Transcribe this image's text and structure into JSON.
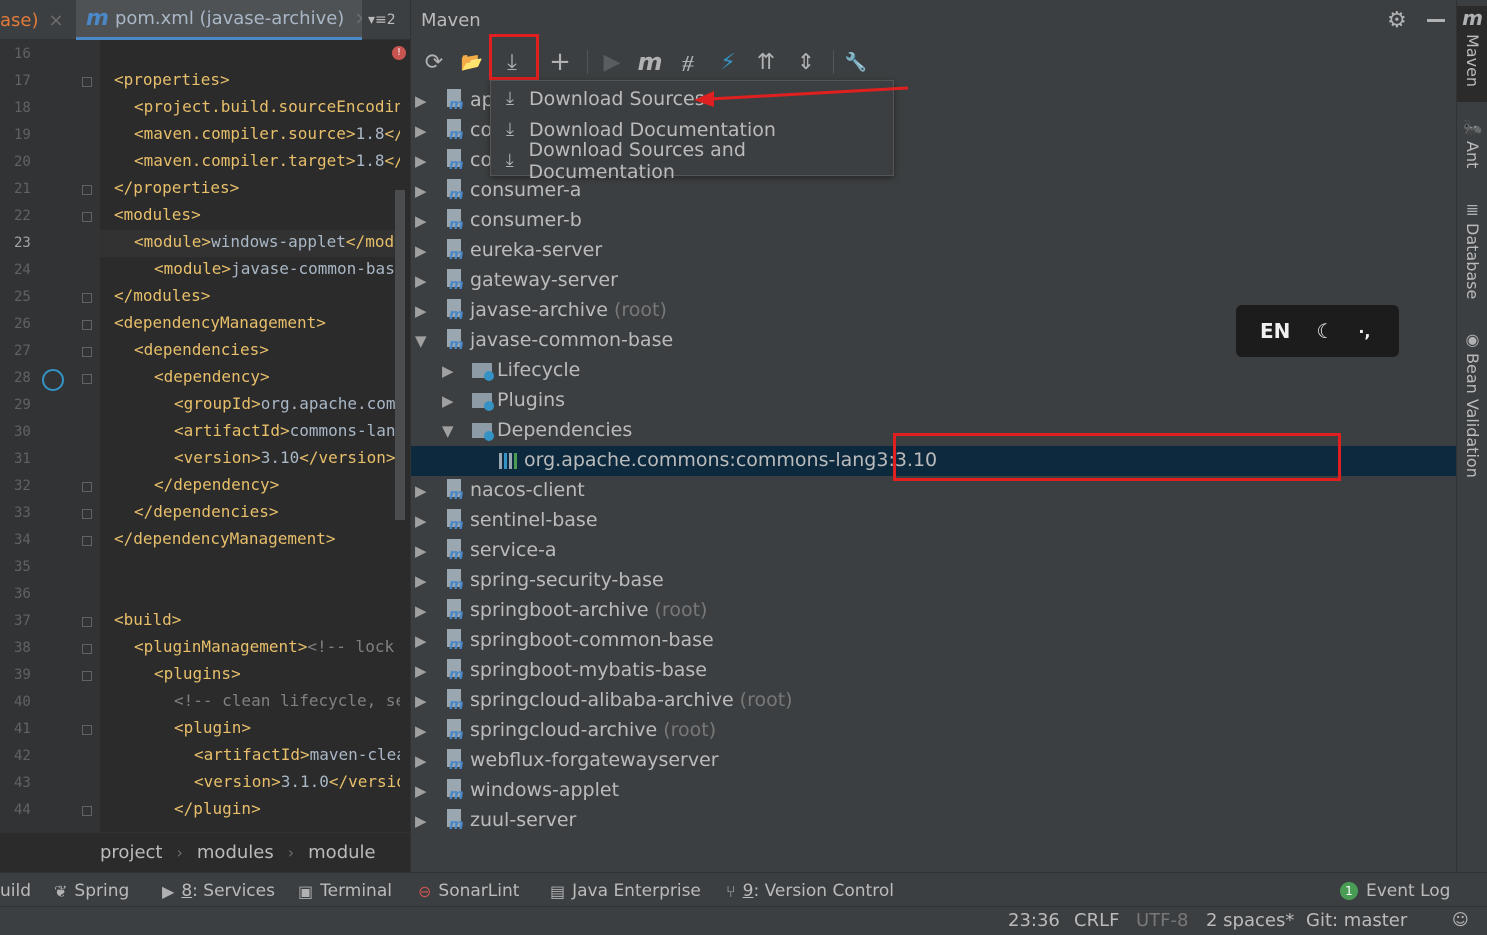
{
  "editor": {
    "tabs": {
      "prev_label": "ase)",
      "active_label": "pom.xml (javase-archive)",
      "active_icon": "m",
      "close_glyph": "×",
      "menu_label": "▾≡2"
    },
    "line_numbers": [
      "16",
      "17",
      "18",
      "19",
      "20",
      "21",
      "22",
      "23",
      "24",
      "25",
      "26",
      "27",
      "28",
      "29",
      "30",
      "31",
      "32",
      "33",
      "34",
      "35",
      "36",
      "37",
      "38",
      "39",
      "40",
      "41",
      "42",
      "43",
      "44"
    ],
    "code_lines": [
      {
        "n": "17",
        "indent": 0,
        "parts": [
          [
            "t",
            "<properties>"
          ]
        ]
      },
      {
        "n": "18",
        "indent": 1,
        "parts": [
          [
            "t",
            "<project.build.sourceEncodin"
          ]
        ]
      },
      {
        "n": "19",
        "indent": 1,
        "parts": [
          [
            "t",
            "<maven.compiler.source>"
          ],
          [
            "x",
            "1.8"
          ],
          [
            "t",
            "</"
          ]
        ]
      },
      {
        "n": "20",
        "indent": 1,
        "parts": [
          [
            "t",
            "<maven.compiler.target>"
          ],
          [
            "x",
            "1.8"
          ],
          [
            "t",
            "</"
          ]
        ]
      },
      {
        "n": "21",
        "indent": 0,
        "parts": [
          [
            "t",
            "</properties>"
          ]
        ]
      },
      {
        "n": "22",
        "indent": 0,
        "parts": [
          [
            "t",
            "<modules>"
          ]
        ]
      },
      {
        "n": "23",
        "indent": 1,
        "parts": [
          [
            "t",
            "<module>"
          ],
          [
            "x",
            "windows-applet"
          ],
          [
            "t",
            "</modu"
          ]
        ]
      },
      {
        "n": "24",
        "indent": 2,
        "parts": [
          [
            "t",
            "<module>"
          ],
          [
            "x",
            "javase-common-base"
          ]
        ]
      },
      {
        "n": "25",
        "indent": 0,
        "parts": [
          [
            "t",
            "</modules>"
          ]
        ]
      },
      {
        "n": "26",
        "indent": 0,
        "parts": [
          [
            "t",
            "<dependencyManagement>"
          ]
        ]
      },
      {
        "n": "27",
        "indent": 1,
        "parts": [
          [
            "t",
            "<dependencies>"
          ]
        ]
      },
      {
        "n": "28",
        "indent": 2,
        "parts": [
          [
            "t",
            "<dependency>"
          ]
        ]
      },
      {
        "n": "29",
        "indent": 3,
        "parts": [
          [
            "t",
            "<groupId>"
          ],
          [
            "x",
            "org.apache.comm"
          ]
        ]
      },
      {
        "n": "30",
        "indent": 3,
        "parts": [
          [
            "t",
            "<artifactId>"
          ],
          [
            "x",
            "commons-lang"
          ]
        ]
      },
      {
        "n": "31",
        "indent": 3,
        "parts": [
          [
            "t",
            "<version>"
          ],
          [
            "x",
            "3.10"
          ],
          [
            "t",
            "</version>"
          ]
        ]
      },
      {
        "n": "32",
        "indent": 2,
        "parts": [
          [
            "t",
            "</dependency>"
          ]
        ]
      },
      {
        "n": "33",
        "indent": 1,
        "parts": [
          [
            "t",
            "</dependencies>"
          ]
        ]
      },
      {
        "n": "34",
        "indent": 0,
        "parts": [
          [
            "t",
            "</dependencyManagement>"
          ]
        ]
      },
      {
        "n": "37",
        "indent": 0,
        "parts": [
          [
            "t",
            "<build>"
          ]
        ]
      },
      {
        "n": "38",
        "indent": 1,
        "parts": [
          [
            "t",
            "<pluginManagement>"
          ],
          [
            "c",
            "<!-- lock"
          ]
        ]
      },
      {
        "n": "39",
        "indent": 2,
        "parts": [
          [
            "t",
            "<plugins>"
          ]
        ]
      },
      {
        "n": "40",
        "indent": 3,
        "parts": [
          [
            "c",
            "<!-- clean lifecycle, se"
          ]
        ]
      },
      {
        "n": "41",
        "indent": 3,
        "parts": [
          [
            "t",
            "<plugin>"
          ]
        ]
      },
      {
        "n": "42",
        "indent": 4,
        "parts": [
          [
            "t",
            "<artifactId>"
          ],
          [
            "x",
            "maven-clea"
          ]
        ]
      },
      {
        "n": "43",
        "indent": 4,
        "parts": [
          [
            "t",
            "<version>"
          ],
          [
            "x",
            "3.1.0"
          ],
          [
            "t",
            "</versio"
          ]
        ]
      },
      {
        "n": "44",
        "indent": 3,
        "parts": [
          [
            "t",
            "</plugin>"
          ]
        ]
      }
    ],
    "breadcrumb": [
      "project",
      "modules",
      "module"
    ],
    "breadcrumb_sep": "›"
  },
  "maven": {
    "title": "Maven",
    "gear_icon": "⚙",
    "toolbar": {
      "reimport_icon": "⟳",
      "generate_sources_icon": "📂",
      "download_icon": "⤓",
      "add_icon": "+",
      "run_icon": "▶",
      "execute_goal_icon": "m",
      "toggle_offline_icon": "⧣",
      "skip_tests_icon": "⚡",
      "show_deps_icon": "⇈",
      "collapse_icon": "⇕",
      "settings_icon": "🔧"
    },
    "dropdown": [
      {
        "icon": "⤓",
        "label": "Download Sources"
      },
      {
        "icon": "⤓",
        "label": "Download Documentation"
      },
      {
        "icon": "⤓",
        "label": "Download Sources and Documentation"
      }
    ],
    "tree": [
      {
        "label": "ap",
        "suffix": "",
        "level": 0,
        "expanded": false,
        "kind": "module"
      },
      {
        "label": "co",
        "suffix": "",
        "level": 0,
        "expanded": false,
        "kind": "module"
      },
      {
        "label": "co",
        "suffix": "",
        "level": 0,
        "expanded": false,
        "kind": "module"
      },
      {
        "label": "consumer-a",
        "suffix": "",
        "level": 0,
        "expanded": false,
        "kind": "module"
      },
      {
        "label": "consumer-b",
        "suffix": "",
        "level": 0,
        "expanded": false,
        "kind": "module"
      },
      {
        "label": "eureka-server",
        "suffix": "",
        "level": 0,
        "expanded": false,
        "kind": "module"
      },
      {
        "label": "gateway-server",
        "suffix": "",
        "level": 0,
        "expanded": false,
        "kind": "module"
      },
      {
        "label": "javase-archive",
        "suffix": "(root)",
        "level": 0,
        "expanded": false,
        "kind": "module"
      },
      {
        "label": "javase-common-base",
        "suffix": "",
        "level": 0,
        "expanded": true,
        "kind": "module"
      },
      {
        "label": "Lifecycle",
        "suffix": "",
        "level": 1,
        "expanded": false,
        "kind": "folder"
      },
      {
        "label": "Plugins",
        "suffix": "",
        "level": 1,
        "expanded": false,
        "kind": "folder"
      },
      {
        "label": "Dependencies",
        "suffix": "",
        "level": 1,
        "expanded": true,
        "kind": "folder"
      },
      {
        "label": "org.apache.commons:commons-lang3:3.10",
        "suffix": "",
        "level": 2,
        "expanded": null,
        "kind": "library",
        "selected": true
      },
      {
        "label": "nacos-client",
        "suffix": "",
        "level": 0,
        "expanded": false,
        "kind": "module"
      },
      {
        "label": "sentinel-base",
        "suffix": "",
        "level": 0,
        "expanded": false,
        "kind": "module"
      },
      {
        "label": "service-a",
        "suffix": "",
        "level": 0,
        "expanded": false,
        "kind": "module"
      },
      {
        "label": "spring-security-base",
        "suffix": "",
        "level": 0,
        "expanded": false,
        "kind": "module"
      },
      {
        "label": "springboot-archive",
        "suffix": "(root)",
        "level": 0,
        "expanded": false,
        "kind": "module"
      },
      {
        "label": "springboot-common-base",
        "suffix": "",
        "level": 0,
        "expanded": false,
        "kind": "module"
      },
      {
        "label": "springboot-mybatis-base",
        "suffix": "",
        "level": 0,
        "expanded": false,
        "kind": "module"
      },
      {
        "label": "springcloud-alibaba-archive",
        "suffix": "(root)",
        "level": 0,
        "expanded": false,
        "kind": "module"
      },
      {
        "label": "springcloud-archive",
        "suffix": "(root)",
        "level": 0,
        "expanded": false,
        "kind": "module"
      },
      {
        "label": "webflux-forgatewayserver",
        "suffix": "",
        "level": 0,
        "expanded": false,
        "kind": "module"
      },
      {
        "label": "windows-applet",
        "suffix": "",
        "level": 0,
        "expanded": false,
        "kind": "module"
      },
      {
        "label": "zuul-server",
        "suffix": "",
        "level": 0,
        "expanded": false,
        "kind": "module"
      }
    ]
  },
  "ime_indicator": {
    "lang": "EN",
    "moon_icon": "☾",
    "punct_icon": "·,"
  },
  "right_stripe": [
    {
      "label": "Maven",
      "icon": "m",
      "active": true
    },
    {
      "label": "Ant",
      "icon": "🐜",
      "active": false
    },
    {
      "label": "Database",
      "icon": "≣",
      "active": false
    },
    {
      "label": "Bean Validation",
      "icon": "◉",
      "active": false
    }
  ],
  "tool_windows": {
    "build": "uild",
    "spring": "Spring",
    "services_num": "8",
    "services": ": Services",
    "terminal": "Terminal",
    "sonarlint": "SonarLint",
    "java_enterprise": "Java Enterprise",
    "vcs_num": "9",
    "vcs": ": Version Control",
    "event_log_count": "1",
    "event_log": "Event Log"
  },
  "status_bar": {
    "position": "23:36",
    "line_sep": "CRLF",
    "encoding": "UTF-8",
    "indent": "2 spaces*",
    "git": "Git: master"
  },
  "colors": {
    "accent": "#4a88c7",
    "annotation_red": "#e02020",
    "xml_tag": "#e8bf6a",
    "selection": "#0d293e"
  }
}
